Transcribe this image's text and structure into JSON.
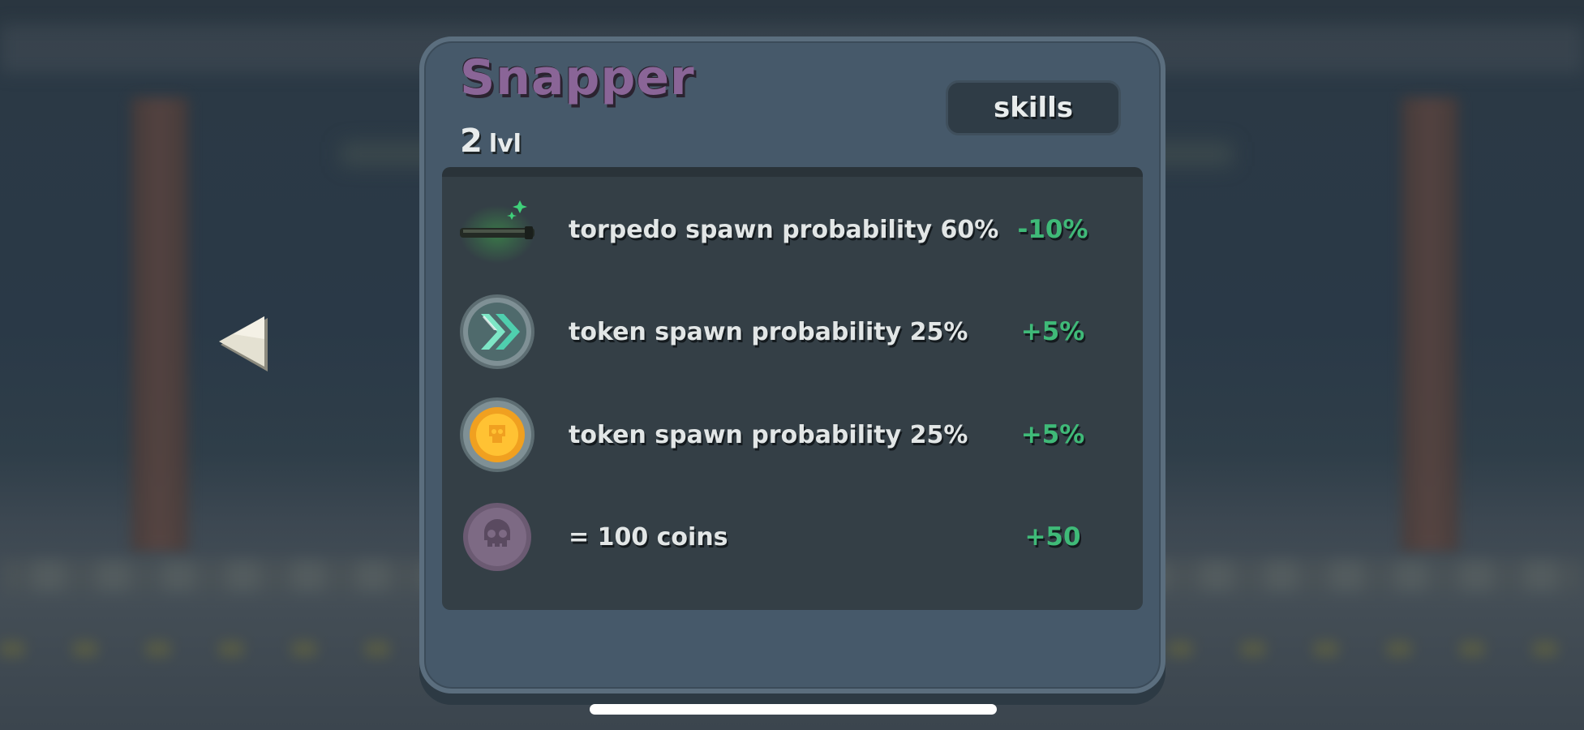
{
  "hero": {
    "name": "Snapper",
    "level_number": "2",
    "level_unit": "lvl"
  },
  "skills_button": {
    "label": "skills"
  },
  "stats": [
    {
      "icon": "torpedo-icon",
      "label": "torpedo spawn probability 60%",
      "delta": "-10%"
    },
    {
      "icon": "speed-chevrons-icon",
      "label": "token spawn probability 25%",
      "delta": "+5%"
    },
    {
      "icon": "coin-token-icon",
      "label": "token spawn probability 25%",
      "delta": "+5%"
    },
    {
      "icon": "skull-icon",
      "label": "= 100 coins",
      "delta": "+50"
    }
  ],
  "navigation": {
    "previous_icon": "left-arrow-icon"
  },
  "colors": {
    "panel": "#46596a",
    "hero_name": "#8a6597",
    "positive_delta": "#3fba78",
    "stats_box": "#343f46"
  }
}
